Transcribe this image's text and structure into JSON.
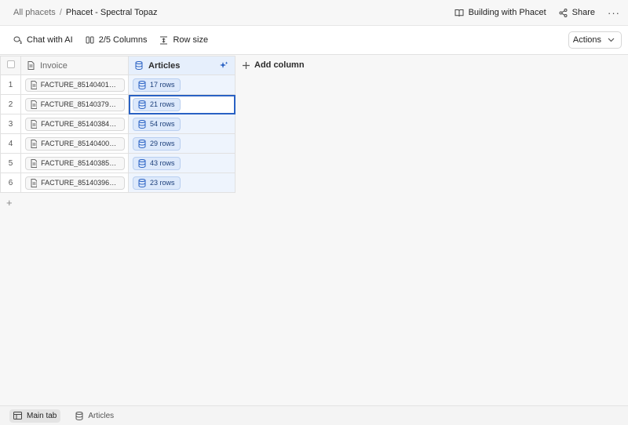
{
  "breadcrumb": {
    "root": "All phacets",
    "separator": "/",
    "current": "Phacet - Spectral Topaz"
  },
  "topbar": {
    "guide_label": "Building with Phacet",
    "share_label": "Share",
    "more_label": "···"
  },
  "toolbar": {
    "chat_label": "Chat with AI",
    "columns_label": "2/5 Columns",
    "rowsize_label": "Row size",
    "actions_label": "Actions"
  },
  "table": {
    "columns": [
      {
        "label": "Invoice",
        "icon": "file-icon"
      },
      {
        "label": "Articles",
        "icon": "database-icon"
      }
    ],
    "add_column_label": "Add column",
    "add_row_label": "+",
    "rows": [
      {
        "num": "1",
        "invoice": "FACTURE_85140401_A3B...",
        "articles": "17 rows"
      },
      {
        "num": "2",
        "invoice": "FACTURE_85140379_A3B...",
        "articles": "21 rows"
      },
      {
        "num": "3",
        "invoice": "FACTURE_85140384_A3...",
        "articles": "54 rows"
      },
      {
        "num": "4",
        "invoice": "FACTURE_85140400_A3...",
        "articles": "29 rows"
      },
      {
        "num": "5",
        "invoice": "FACTURE_85140385_A3...",
        "articles": "43 rows"
      },
      {
        "num": "6",
        "invoice": "FACTURE_85140396_A3...",
        "articles": "23 rows"
      }
    ]
  },
  "bottom_tabs": [
    {
      "label": "Main tab",
      "active": true
    },
    {
      "label": "Articles",
      "active": false
    }
  ],
  "colors": {
    "accent": "#2a62c4",
    "selected_column_bg": "#eef4fd",
    "chip_bg": "#dde9fb"
  }
}
